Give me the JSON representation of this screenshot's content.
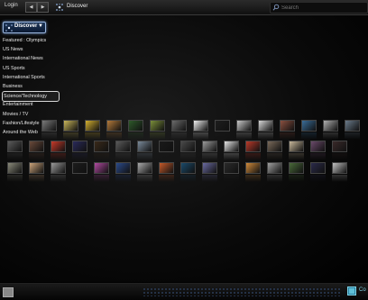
{
  "topbar": {
    "login_label": "Login",
    "back_label": "◀",
    "forward_label": "▶",
    "app_title": "Discover",
    "search_placeholder": "Search"
  },
  "discover_button": {
    "label": "Discover",
    "chevron": "▼"
  },
  "menu": {
    "items": [
      "Featured : Olympics",
      "US News",
      "International News",
      "US Sports",
      "International Sports",
      "Business",
      "Science/Technology",
      "Entertainment",
      "Movies / TV",
      "Fashion/Lifestyle",
      "Around the Web"
    ],
    "selected": "Science/Technology"
  },
  "thumbnails": {
    "row1": [
      "#7a7a7a",
      "#c9b65a",
      "#d4b030",
      "#b47a3a",
      "#2e5a2a",
      "#7a8e3a",
      "#6b6b6b",
      "#f0f0f0",
      "#1e1e1e",
      "#c8c8c8",
      "#d7d7d7",
      "#8a5040",
      "#3a6d99",
      "#b0b0b0",
      "#6a7a8a",
      "#2a2a2a",
      "#9a7a4a",
      "#cf4a2a",
      "#a0a0a0"
    ],
    "row2": [
      "#5a5a5a",
      "#6a4a3a",
      "#c83a2a",
      "#2a2a5a",
      "#3a2a1a",
      "#5a5a5a",
      "#7a8a9a",
      "#1a1a1a",
      "#4a4a4a",
      "#9a9a9a",
      "#e5e5e5",
      "#bb3a2a",
      "#7a6a5a",
      "#c7b79a",
      "#6a4a6a",
      "#3a2a2a",
      "#8a7a5a",
      "#d0a060",
      "#4a4a4a"
    ],
    "row3": [
      "#8a8a7a",
      "#caa37a",
      "#9a9a9a",
      "#1c1c1c",
      "#b04aa0",
      "#2a4a8a",
      "#aaa",
      "#c55a2a",
      "#1a4a6a",
      "#6a6aa0",
      "#2a2a2a",
      "#d08a3a",
      "#a0a0a0",
      "#4a6a3a",
      "#2a2a4a",
      "#c0c0c0",
      "#7a4a2a",
      "#3a5a7a",
      "#9a6a4a"
    ]
  },
  "bottombar": {
    "category_label": "Co",
    "category_color": "#7fd3e6"
  },
  "colors": {
    "accent": "#9cb8e0",
    "selected_border": "#d8d8d8"
  }
}
